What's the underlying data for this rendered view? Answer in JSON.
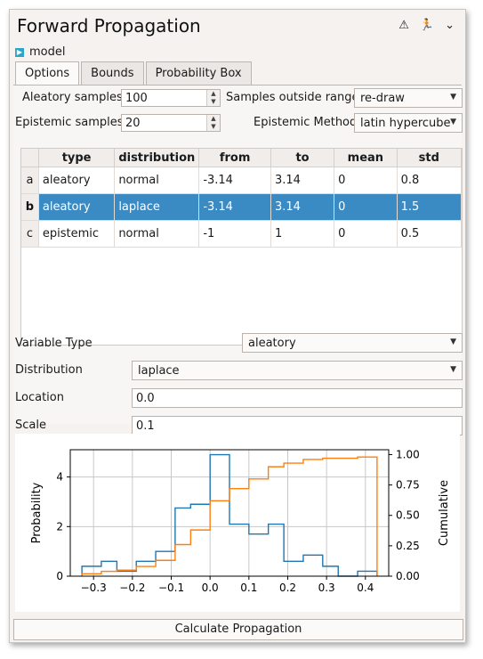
{
  "window": {
    "title": "Forward Propagation",
    "icons": [
      "warning-icon",
      "run-icon",
      "chevron-down-icon"
    ],
    "model_label": "model"
  },
  "tabs": [
    {
      "label": "Options",
      "active": true
    },
    {
      "label": "Bounds",
      "active": false
    },
    {
      "label": "Probability Box",
      "active": false
    }
  ],
  "options": {
    "aleatory_samples_label": "Aleatory samples",
    "aleatory_samples_value": "100",
    "samples_outside_label": "Samples outside range",
    "samples_outside_value": "re-draw",
    "epistemic_samples_label": "Epistemic samples",
    "epistemic_samples_value": "20",
    "epistemic_method_label": "Epistemic Method",
    "epistemic_method_value": "latin hypercube"
  },
  "table": {
    "headers": [
      "type",
      "distribution",
      "from",
      "to",
      "mean",
      "std"
    ],
    "rows": [
      {
        "id": "a",
        "cells": [
          "aleatory",
          "normal",
          "-3.14",
          "3.14",
          "0",
          "0.8"
        ],
        "selected": false
      },
      {
        "id": "b",
        "cells": [
          "aleatory",
          "laplace",
          "-3.14",
          "3.14",
          "0",
          "1.5"
        ],
        "selected": true
      },
      {
        "id": "c",
        "cells": [
          "epistemic",
          "normal",
          "-1",
          "1",
          "0",
          "0.5"
        ],
        "selected": false
      }
    ]
  },
  "detail": {
    "variable_type_label": "Variable Type",
    "variable_type_value": "aleatory",
    "distribution_label": "Distribution",
    "distribution_value": "laplace",
    "location_label": "Location",
    "location_value": "0.0",
    "scale_label": "Scale",
    "scale_value": "0.1"
  },
  "chart_data": {
    "type": "line",
    "xlabel": "",
    "ylabel": "Probability",
    "y2label": "Cumulative",
    "xlim": [
      -0.36,
      0.46
    ],
    "ylim": [
      0,
      5.1
    ],
    "y2lim": [
      0,
      1.04
    ],
    "xticks": [
      -0.3,
      -0.2,
      -0.1,
      0.0,
      0.1,
      0.2,
      0.3,
      0.4
    ],
    "xtick_labels": [
      "−0.3",
      "−0.2",
      "−0.1",
      "0.0",
      "0.1",
      "0.2",
      "0.3",
      "0.4"
    ],
    "yticks": [
      0,
      2,
      4
    ],
    "ytick_labels": [
      "0",
      "2",
      "4"
    ],
    "y2ticks": [
      0.0,
      0.25,
      0.5,
      0.75,
      1.0
    ],
    "y2tick_labels": [
      "0.00",
      "0.25",
      "0.50",
      "0.75",
      "1.00"
    ],
    "grid": true,
    "series": [
      {
        "color": "#1f77b4",
        "step": true,
        "edges": [
          -0.33,
          -0.28,
          -0.24,
          -0.19,
          -0.14,
          -0.09,
          -0.05,
          0.0,
          0.05,
          0.1,
          0.15,
          0.19,
          0.24,
          0.29,
          0.33,
          0.38,
          0.43
        ],
        "values": [
          0.4,
          0.6,
          0.2,
          0.6,
          1.0,
          2.75,
          2.9,
          4.9,
          2.1,
          1.7,
          2.1,
          0.6,
          0.85,
          0.4,
          0.0,
          0.2
        ]
      },
      {
        "color": "#ff7f0e",
        "step": true,
        "axis": "right",
        "edges": [
          -0.33,
          -0.28,
          -0.24,
          -0.19,
          -0.14,
          -0.09,
          -0.05,
          0.0,
          0.05,
          0.1,
          0.15,
          0.19,
          0.24,
          0.29,
          0.33,
          0.38,
          0.43
        ],
        "values": [
          0.02,
          0.04,
          0.05,
          0.08,
          0.13,
          0.26,
          0.38,
          0.62,
          0.72,
          0.8,
          0.9,
          0.93,
          0.96,
          0.97,
          0.97,
          0.98
        ]
      }
    ]
  },
  "actions": {
    "calculate_label": "Calculate Propagation"
  }
}
